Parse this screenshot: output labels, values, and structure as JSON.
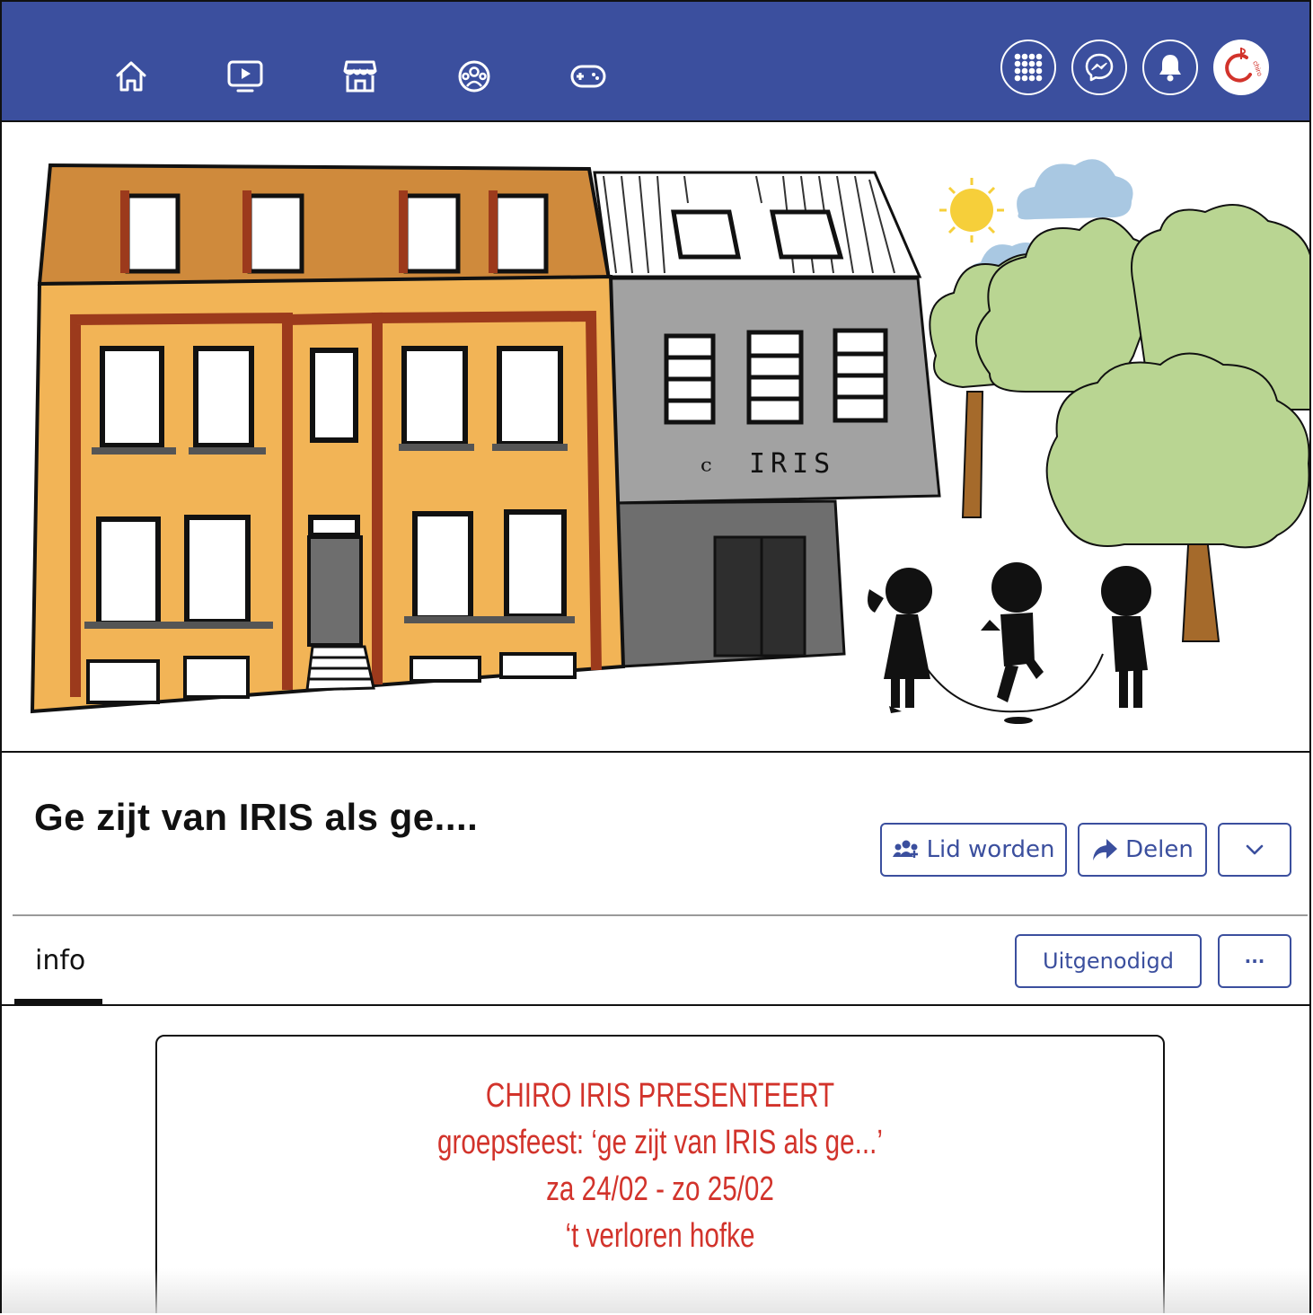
{
  "nav": {
    "icons": [
      "home-icon",
      "watch-icon",
      "marketplace-icon",
      "groups-icon",
      "gaming-icon"
    ],
    "right": [
      "menu-grid-icon",
      "messenger-icon",
      "notifications-icon",
      "chiro-avatar"
    ],
    "avatar_text": "chiro"
  },
  "cover": {
    "building_sign": "IRIS"
  },
  "group": {
    "title": "Ge zijt van IRIS als ge....",
    "join_label": "Lid worden",
    "share_label": "Delen"
  },
  "tabs": {
    "info_label": "info",
    "invited_label": "Uitgenodigd",
    "more_label": "···"
  },
  "post": {
    "line1": "CHIRO IRIS PRESENTEERT",
    "line2": "groepsfeest: ‘ge zijt van IRIS als ge...’",
    "line3": "za 24/02 - zo 25/02",
    "line4": "‘t verloren hofke"
  },
  "colors": {
    "brand_blue": "#3b4f9e",
    "post_red": "#d2332b"
  }
}
